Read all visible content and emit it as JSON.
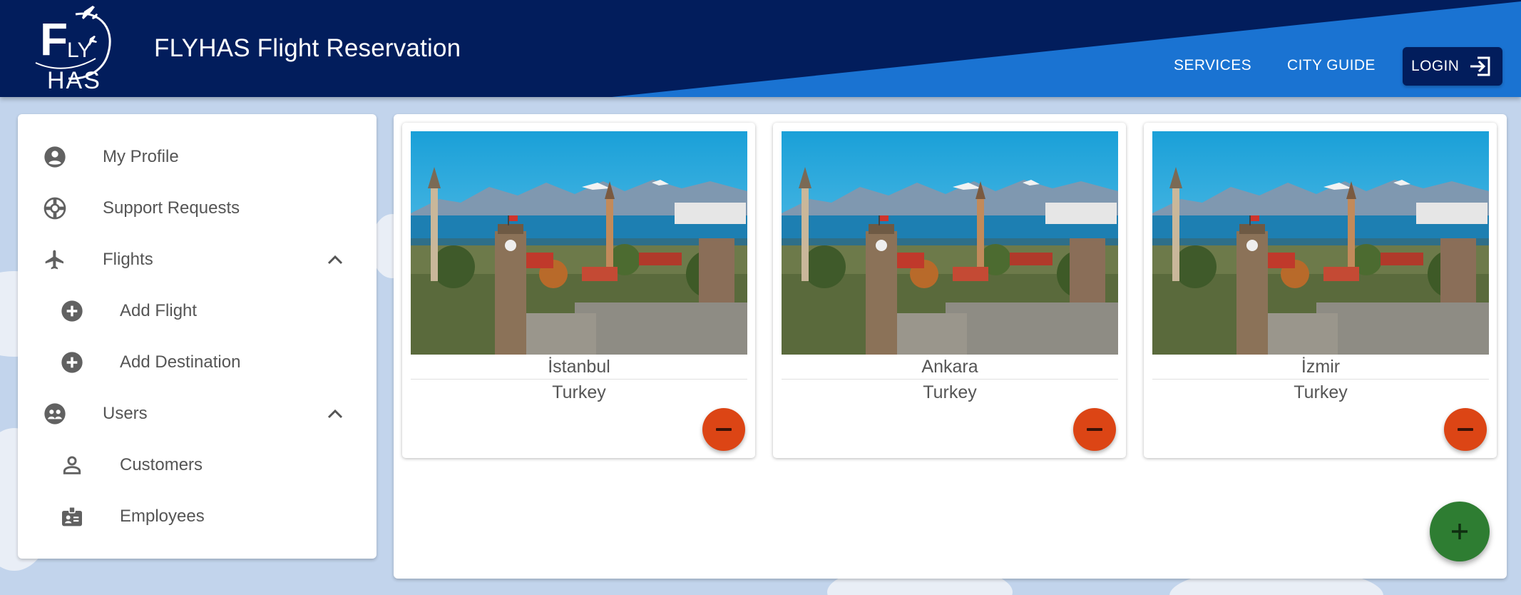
{
  "header": {
    "logo_text_top": "F",
    "logo_text_ly": "LY",
    "logo_text_bottom": "HAS",
    "title": "FLYHAS Flight Reservation",
    "nav": {
      "services": "SERVICES",
      "city_guide": "CITY GUIDE",
      "login": "LOGIN"
    },
    "colors": {
      "navy": "#021d5c",
      "blue": "#1a73d2"
    }
  },
  "sidebar": {
    "items": [
      {
        "label": "My Profile",
        "icon": "account-circle-icon"
      },
      {
        "label": "Support Requests",
        "icon": "lifebuoy-icon"
      },
      {
        "label": "Flights",
        "icon": "airplane-icon",
        "expanded": true
      },
      {
        "label": "Add Flight",
        "icon": "add-circle-icon"
      },
      {
        "label": "Add Destination",
        "icon": "add-circle-icon"
      },
      {
        "label": "Users",
        "icon": "users-icon",
        "expanded": true
      },
      {
        "label": "Customers",
        "icon": "person-outline-icon"
      },
      {
        "label": "Employees",
        "icon": "badge-icon"
      }
    ]
  },
  "destinations": [
    {
      "city": "İstanbul",
      "country": "Turkey"
    },
    {
      "city": "Ankara",
      "country": "Turkey"
    },
    {
      "city": "İzmir",
      "country": "Turkey"
    }
  ],
  "colors": {
    "remove": "#dc4515",
    "add": "#2e7d32"
  }
}
